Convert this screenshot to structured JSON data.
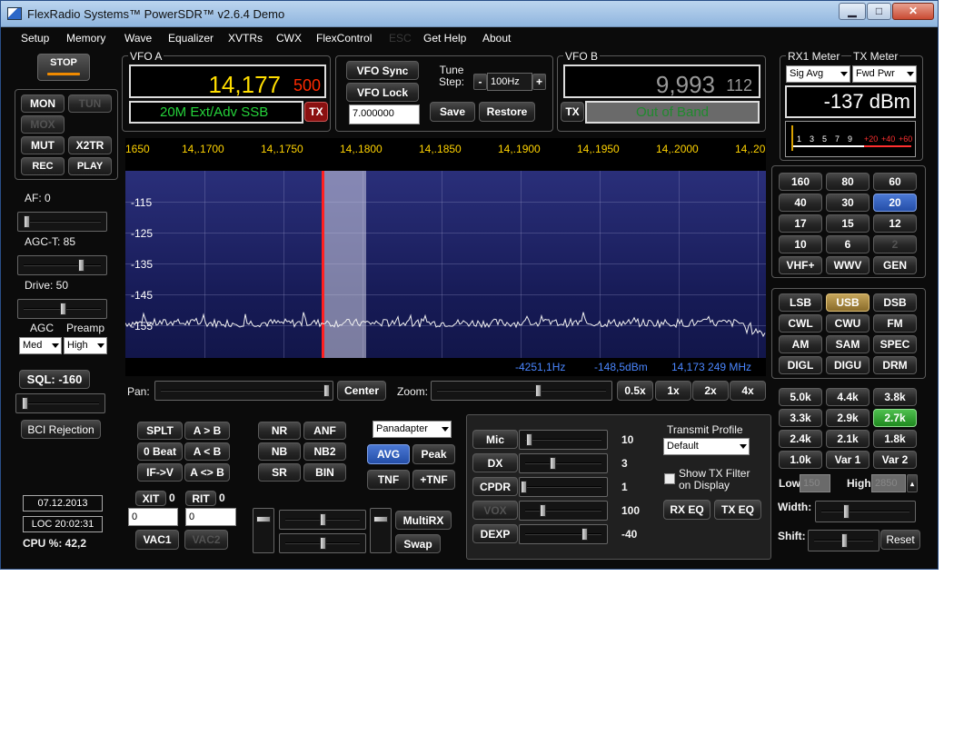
{
  "window": {
    "title": "FlexRadio Systems™  PowerSDR™  v2.6.4   Demo",
    "min": "▁",
    "max": "□",
    "close": "✕"
  },
  "menu": [
    "Setup",
    "Memory",
    "Wave",
    "Equalizer",
    "XVTRs",
    "CWX",
    "FlexControl",
    "ESC",
    "Get Help",
    "About"
  ],
  "left": {
    "stop": "STOP",
    "mon": "MON",
    "tun": "TUN",
    "mox": "MOX",
    "mut": "MUT",
    "x2tr": "X2TR",
    "rec": "REC",
    "play": "PLAY",
    "af": "AF:  0",
    "agct": "AGC-T:  85",
    "drive": "Drive:  50",
    "agc": "AGC",
    "preamp": "Preamp",
    "agc_val": "Med",
    "preamp_val": "High",
    "sql": "SQL: -160",
    "bci": "BCI Rejection",
    "date": "07.12.2013",
    "loc": "LOC 20:02:31",
    "cpu": "CPU %: 42,2"
  },
  "vfoa": {
    "title": "VFO A",
    "big": "14,177",
    "small": "500",
    "band": "20M Ext/Adv SSB",
    "tx": "TX"
  },
  "center": {
    "vfo_sync": "VFO Sync",
    "vfo_lock": "VFO Lock",
    "tune_step": "Tune\nStep:",
    "step_minus": "-",
    "step_val": "100Hz",
    "step_plus": "+",
    "freq_field": "7.000000",
    "save": "Save",
    "restore": "Restore"
  },
  "vfob": {
    "title": "VFO B",
    "big": "9,993",
    "small": "112",
    "tx": "TX",
    "band": "Out of Band"
  },
  "meter": {
    "rx_label": "RX1 Meter",
    "tx_label": "TX Meter",
    "rx_sel": "Sig Avg",
    "tx_sel": "Fwd Pwr",
    "reading": "-137 dBm",
    "scale": [
      "1",
      "3",
      "5",
      "7",
      "9"
    ],
    "scale_red": [
      "+20",
      "+40",
      "+60"
    ]
  },
  "pan": {
    "ticks": [
      "1650",
      "14,.1700",
      "14,.1750",
      "14,.1800",
      "14,.1850",
      "14,.1900",
      "14,.1950",
      "14,.2000",
      "14,.20"
    ],
    "db": [
      "-115",
      "-125",
      "-135",
      "-145",
      "-155"
    ],
    "readout_offset": "-4251,1Hz",
    "readout_dbm": "-148,5dBm",
    "readout_freq": "14,173 249 MHz",
    "pan_label": "Pan:",
    "center": "Center",
    "zoom_label": "Zoom:",
    "zoom": [
      "0.5x",
      "1x",
      "2x",
      "4x"
    ]
  },
  "bands": [
    [
      "160",
      "80",
      "60"
    ],
    [
      "40",
      "30",
      "20"
    ],
    [
      "17",
      "15",
      "12"
    ],
    [
      "10",
      "6",
      "2"
    ],
    [
      "VHF+",
      "WWV",
      "GEN"
    ]
  ],
  "modes": [
    [
      "LSB",
      "USB",
      "DSB"
    ],
    [
      "CWL",
      "CWU",
      "FM"
    ],
    [
      "AM",
      "SAM",
      "SPEC"
    ],
    [
      "DIGL",
      "DIGU",
      "DRM"
    ]
  ],
  "filters": [
    [
      "5.0k",
      "4.4k",
      "3.8k"
    ],
    [
      "3.3k",
      "2.9k",
      "2.7k"
    ],
    [
      "2.4k",
      "2.1k",
      "1.8k"
    ],
    [
      "1.0k",
      "Var 1",
      "Var 2"
    ]
  ],
  "filter_ctl": {
    "low": "Low",
    "low_val": "150",
    "high": "High",
    "high_val": "2850",
    "width": "Width:",
    "shift": "Shift:",
    "reset": "Reset"
  },
  "vfoctl": {
    "splt": "SPLT",
    "atob": "A > B",
    "zerobeat": "0 Beat",
    "btoa": "A < B",
    "ifv": "IF->V",
    "swap": "A <> B",
    "xit": "XIT",
    "xit_n": "0",
    "rit": "RIT",
    "rit_n": "0",
    "xit_val": "0",
    "rit_val": "0",
    "vac1": "VAC1",
    "vac2": "VAC2"
  },
  "dsp": {
    "nr": "NR",
    "anf": "ANF",
    "nb": "NB",
    "nb2": "NB2",
    "sr": "SR",
    "bin": "BIN",
    "display": "Panadapter",
    "avg": "AVG",
    "peak": "Peak",
    "tnf": "TNF",
    "ptnf": "+TNF",
    "multirx": "MultiRX",
    "swap": "Swap"
  },
  "tx": {
    "mic": "Mic",
    "mic_v": "10",
    "dx": "DX",
    "dx_v": "3",
    "cpdr": "CPDR",
    "cpdr_v": "1",
    "vox": "VOX",
    "vox_v": "100",
    "dexp": "DEXP",
    "dexp_v": "-40",
    "profile_label": "Transmit Profile",
    "profile": "Default",
    "show_filter": "Show TX Filter\non Display",
    "rxeq": "RX EQ",
    "txeq": "TX EQ"
  }
}
